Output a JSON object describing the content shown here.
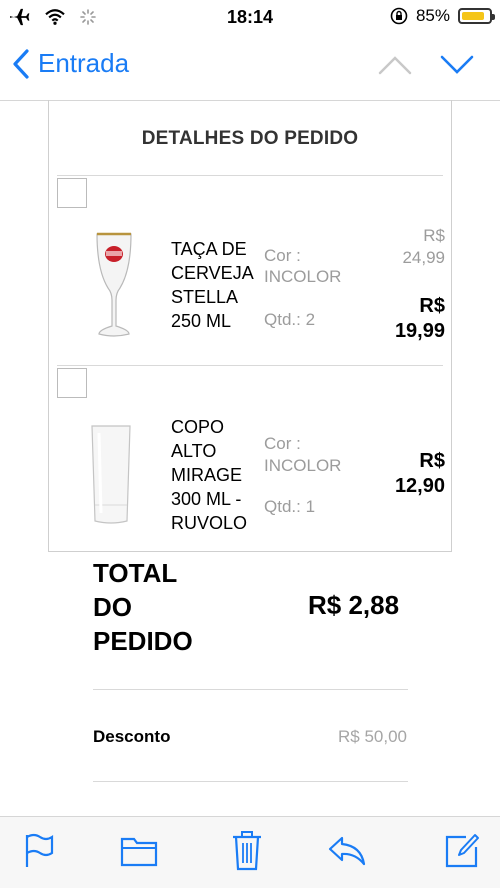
{
  "status": {
    "time": "18:14",
    "battery": "85%",
    "battery_level": 0.85
  },
  "nav": {
    "back_label": "Entrada"
  },
  "order": {
    "title": "DETALHES DO PEDIDO",
    "items": [
      {
        "name": "TAÇA DE\nCERVEJA\nSTELLA\n250 ML",
        "color_label": "Cor :",
        "color_value": "INCOLOR",
        "qty": "Qtd.: 2",
        "old_price": "R$\n24,99",
        "price": "R$\n19,99"
      },
      {
        "name": "COPO\nALTO\nMIRAGE\n300 ML -\nRUVOLO",
        "color_label": "Cor :",
        "color_value": "INCOLOR",
        "qty": "Qtd.: 1",
        "price": "R$\n12,90"
      }
    ],
    "total_label": "TOTAL\nDO\nPEDIDO",
    "total_value": "R$ 2,88",
    "discount_label": "Desconto",
    "discount_value": "R$ 50,00"
  },
  "colors": {
    "accent": "#1a7cf5"
  }
}
